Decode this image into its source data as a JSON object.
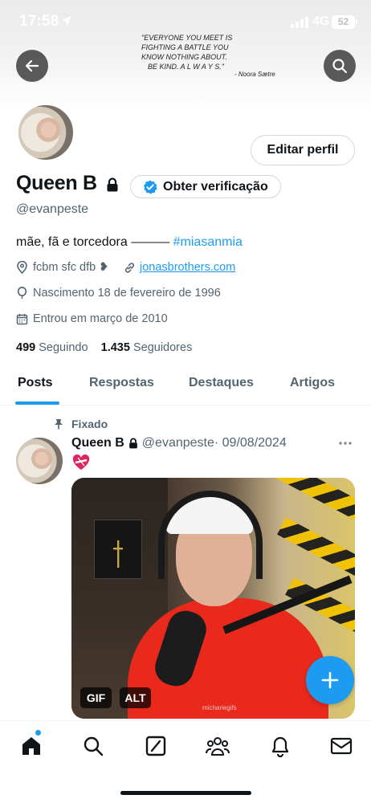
{
  "status_bar": {
    "time": "17:58",
    "network": "4G",
    "battery": "52"
  },
  "banner": {
    "quote_lines": [
      "\"EVERYONE YOU MEET IS",
      "FIGHTING A BATTLE YOU",
      "KNOW NOTHING ABOUT.",
      "BE KIND. A L W A Y S.\""
    ],
    "quote_author": "- Noora Sætre"
  },
  "profile": {
    "name": "Queen B",
    "handle": "@evanpeste",
    "edit_label": "Editar perfil",
    "verify_label": "Obter verificação",
    "bio_text": "mãe, fã e torcedora ——— ",
    "bio_hashtag": "#miasanmia",
    "location": "fcbm sfc dfb ❥",
    "link": "jonasbrothers.com",
    "birth": "Nascimento 18 de fevereiro de 1996",
    "joined": "Entrou em março de 2010",
    "following_count": "499",
    "following_label": "Seguindo",
    "followers_count": "1.435",
    "followers_label": "Seguidores"
  },
  "tabs": [
    {
      "label": "Posts",
      "active": true
    },
    {
      "label": "Respostas",
      "active": false
    },
    {
      "label": "Destaques",
      "active": false
    },
    {
      "label": "Artigos",
      "active": false
    }
  ],
  "post": {
    "pinned_label": "Fixado",
    "author_name": "Queen B",
    "author_handle": "@evanpeste",
    "date": " · 09/08/2024",
    "emoji": "❤️‍🩹",
    "media_watermark": "michariegifs",
    "gif_label": "GIF",
    "alt_label": "ALT"
  },
  "nav": [
    "home-icon",
    "search-icon",
    "grok-icon",
    "communities-icon",
    "notifications-icon",
    "messages-icon"
  ],
  "colors": {
    "accent": "#1d9bf0",
    "text": "#0f1419",
    "muted": "#536471"
  }
}
